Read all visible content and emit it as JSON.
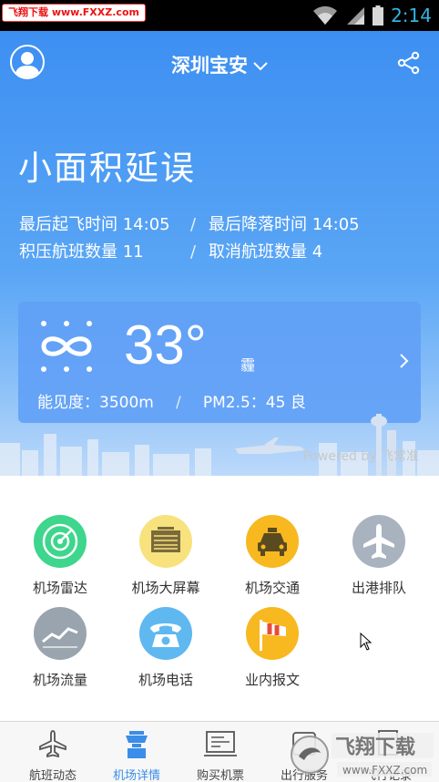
{
  "statusbar": {
    "watermark": "飞翔下载 www.FXXZ.com",
    "time": "2:14",
    "icons": [
      "wifi-icon",
      "signal-icon",
      "battery-icon"
    ]
  },
  "header": {
    "city": "深圳宝安",
    "status_title": "小面积延误",
    "last_takeoff_label": "最后起飞时间 14:05",
    "last_landing_label": "最后降落时间 14:05",
    "backlog_label": "积压航班数量 11",
    "cancelled_label": "取消航班数量 4",
    "separator": "/"
  },
  "weather": {
    "temperature": "33°",
    "description": "霾",
    "visibility": "能见度：3500m",
    "pm25": "PM2.5：45 良",
    "separator": "/"
  },
  "powered_by": "Powered by 飞常准",
  "grid": [
    {
      "label": "机场雷达",
      "icon": "radar-icon",
      "color": "#3dd68c"
    },
    {
      "label": "机场大屏幕",
      "icon": "board-icon",
      "color": "#f8e27e"
    },
    {
      "label": "机场交通",
      "icon": "taxi-icon",
      "color": "#f7b820"
    },
    {
      "label": "出港排队",
      "icon": "plane-icon",
      "color": "#a9b3bf"
    },
    {
      "label": "机场流量",
      "icon": "chart-icon",
      "color": "#9aa4ae"
    },
    {
      "label": "机场电话",
      "icon": "phone-icon",
      "color": "#5fb8f0"
    },
    {
      "label": "业内报文",
      "icon": "windsock-icon",
      "color": "#f7b820"
    }
  ],
  "tabs": [
    {
      "label": "航班动态",
      "icon": "plane-tab-icon"
    },
    {
      "label": "机场详情",
      "icon": "tower-tab-icon"
    },
    {
      "label": "购买机票",
      "icon": "ticket-tab-icon"
    },
    {
      "label": "出行服务",
      "icon": "service-tab-icon"
    },
    {
      "label": "飞行记录",
      "icon": "record-tab-icon"
    }
  ],
  "logo_watermark": {
    "brand": "飞翔下载",
    "url": "www.FXXZ.com"
  },
  "colors": {
    "accent": "#3a8de8",
    "header_top": "#3d8ff2"
  }
}
